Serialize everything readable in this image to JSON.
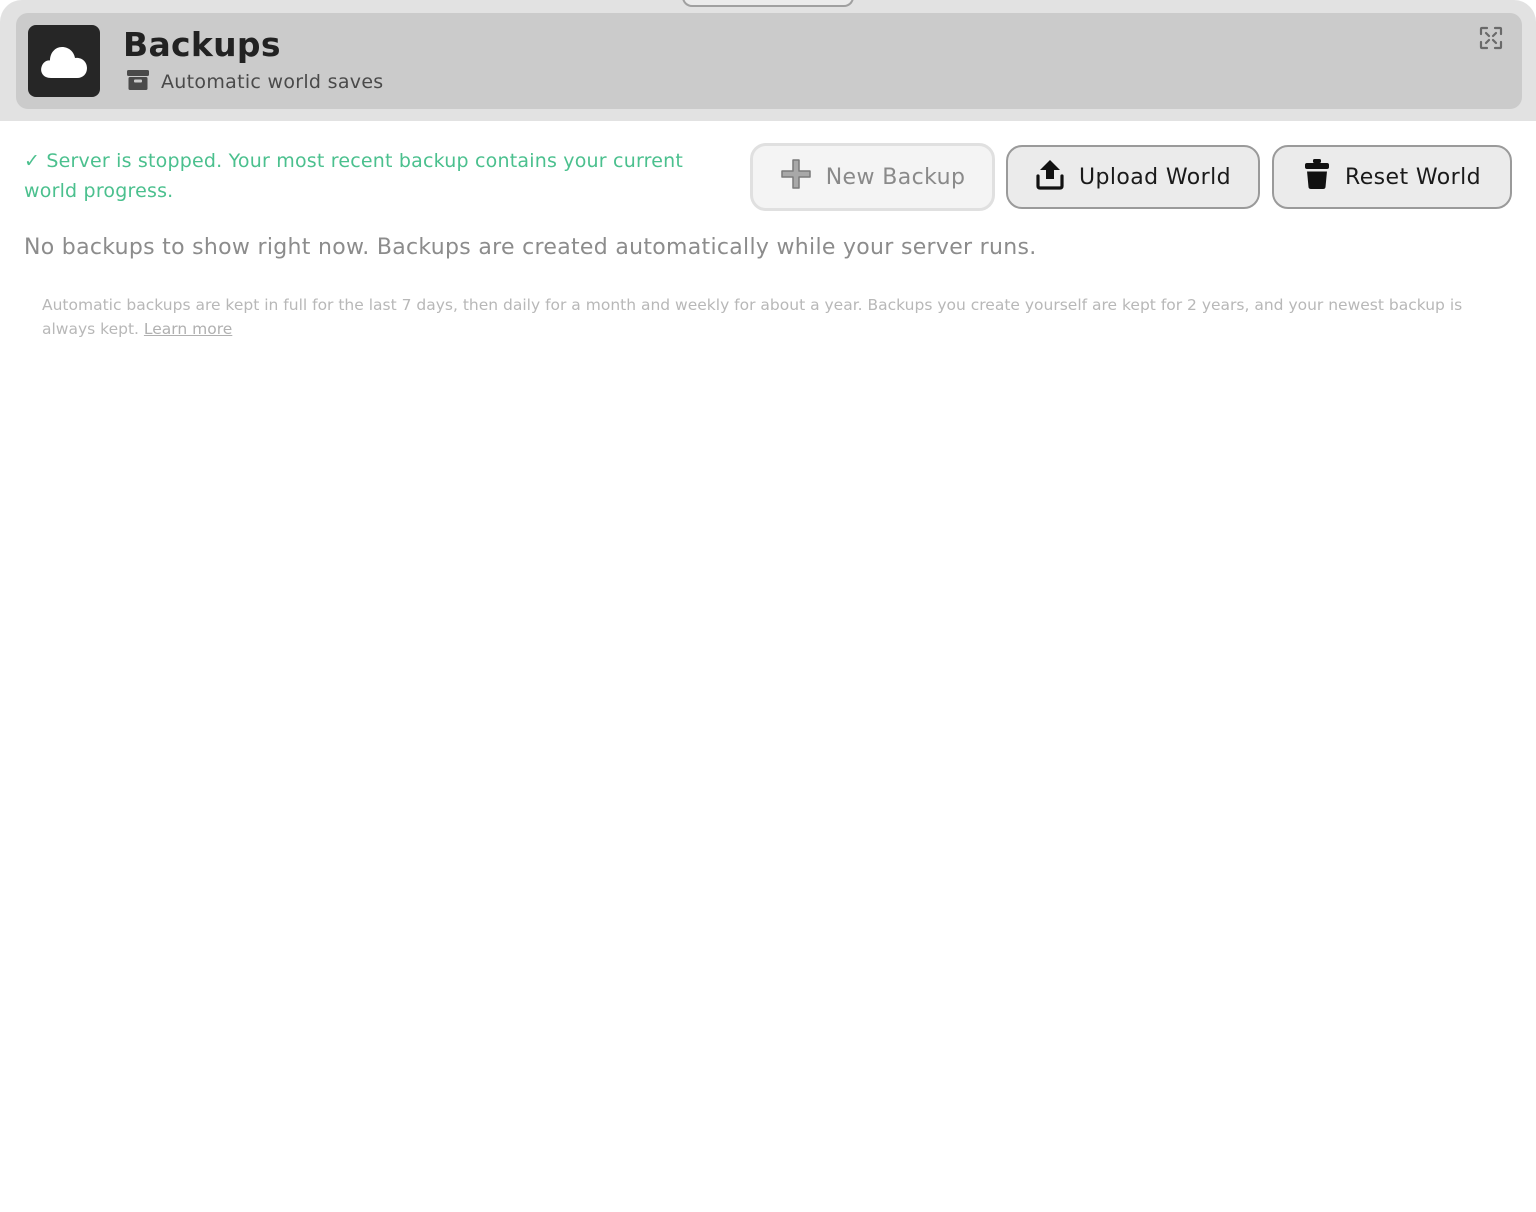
{
  "header": {
    "title": "Backups",
    "subtitle": "Automatic world saves",
    "app_icon": "cloud-icon",
    "subtitle_icon": "archive-box-icon",
    "expand_icon": "expand-icon"
  },
  "status": {
    "message": "✓ Server is stopped. Your most recent backup contains your current world progress.",
    "color": "#4bc08e"
  },
  "actions": {
    "new_backup": {
      "label": "New Backup",
      "icon": "plus-icon",
      "state": "disabled"
    },
    "upload_world": {
      "label": "Upload World",
      "icon": "upload-icon"
    },
    "reset_world": {
      "label": "Reset World",
      "icon": "trash-bin-icon"
    }
  },
  "empty_state": {
    "message": "No backups to show right now. Backups are created automatically while your server runs."
  },
  "retention": {
    "text": "Automatic backups are kept in full for the last 7 days, then daily for a month and weekly for about a year. Backups you create yourself are kept for 2 years, and your newest backup is always kept.",
    "link_label": "Learn more"
  }
}
